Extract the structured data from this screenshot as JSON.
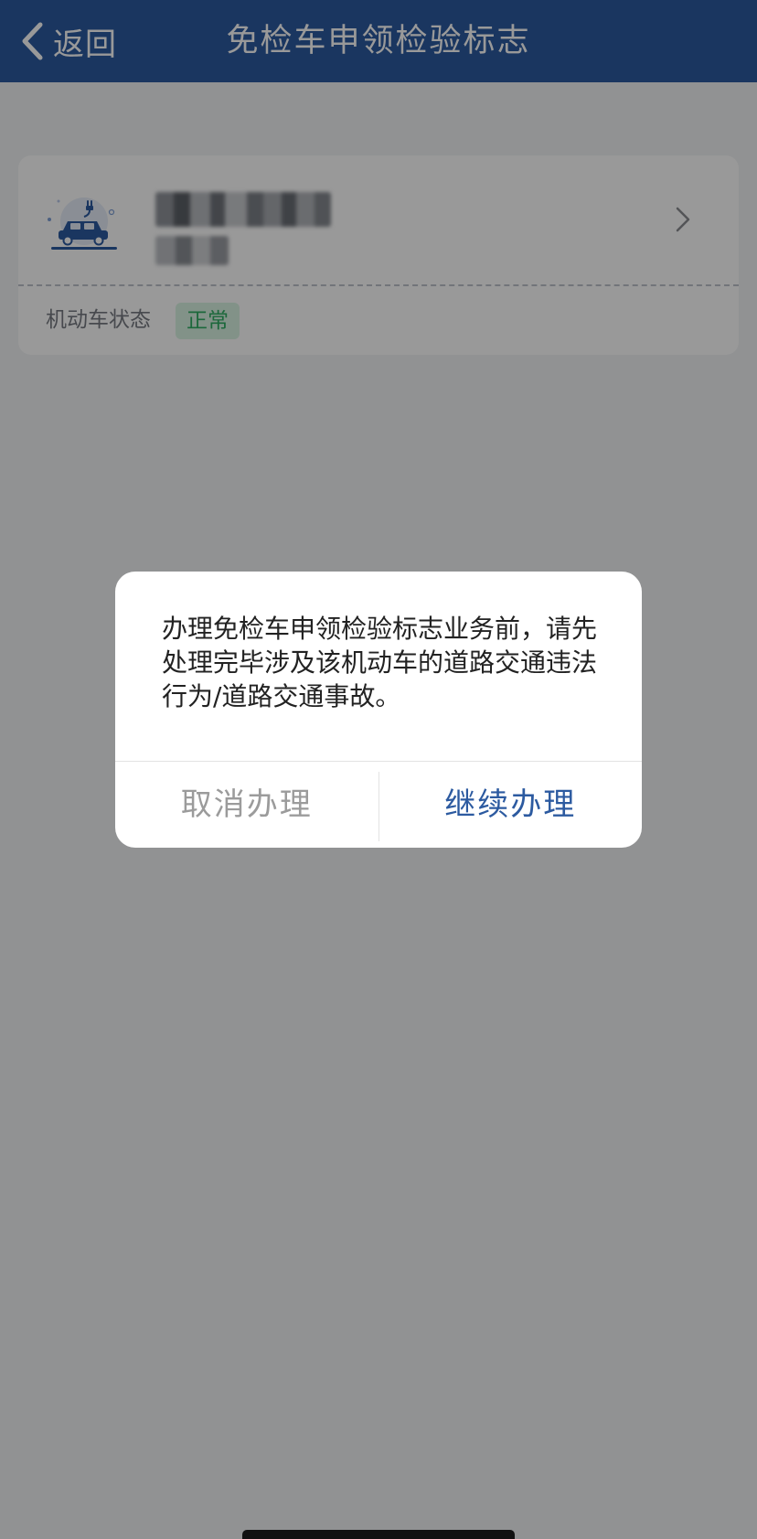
{
  "navbar": {
    "back_label": "返回",
    "title": "免检车申领检验标志"
  },
  "vehicle_card": {
    "icon": "electric-car-icon",
    "plate_number": "",
    "vehicle_type": "",
    "status_label": "机动车状态",
    "status_value": "正常"
  },
  "dialog": {
    "message": "办理免检车申领检验标志业务前，请先处理完毕涉及该机动车的道路交通违法行为/道路交通事故。",
    "cancel_label": "取消办理",
    "continue_label": "继续办理"
  },
  "colors": {
    "brand_blue": "#2c5aa0",
    "status_green": "#2fae63",
    "status_green_bg": "#d9f3e3"
  }
}
